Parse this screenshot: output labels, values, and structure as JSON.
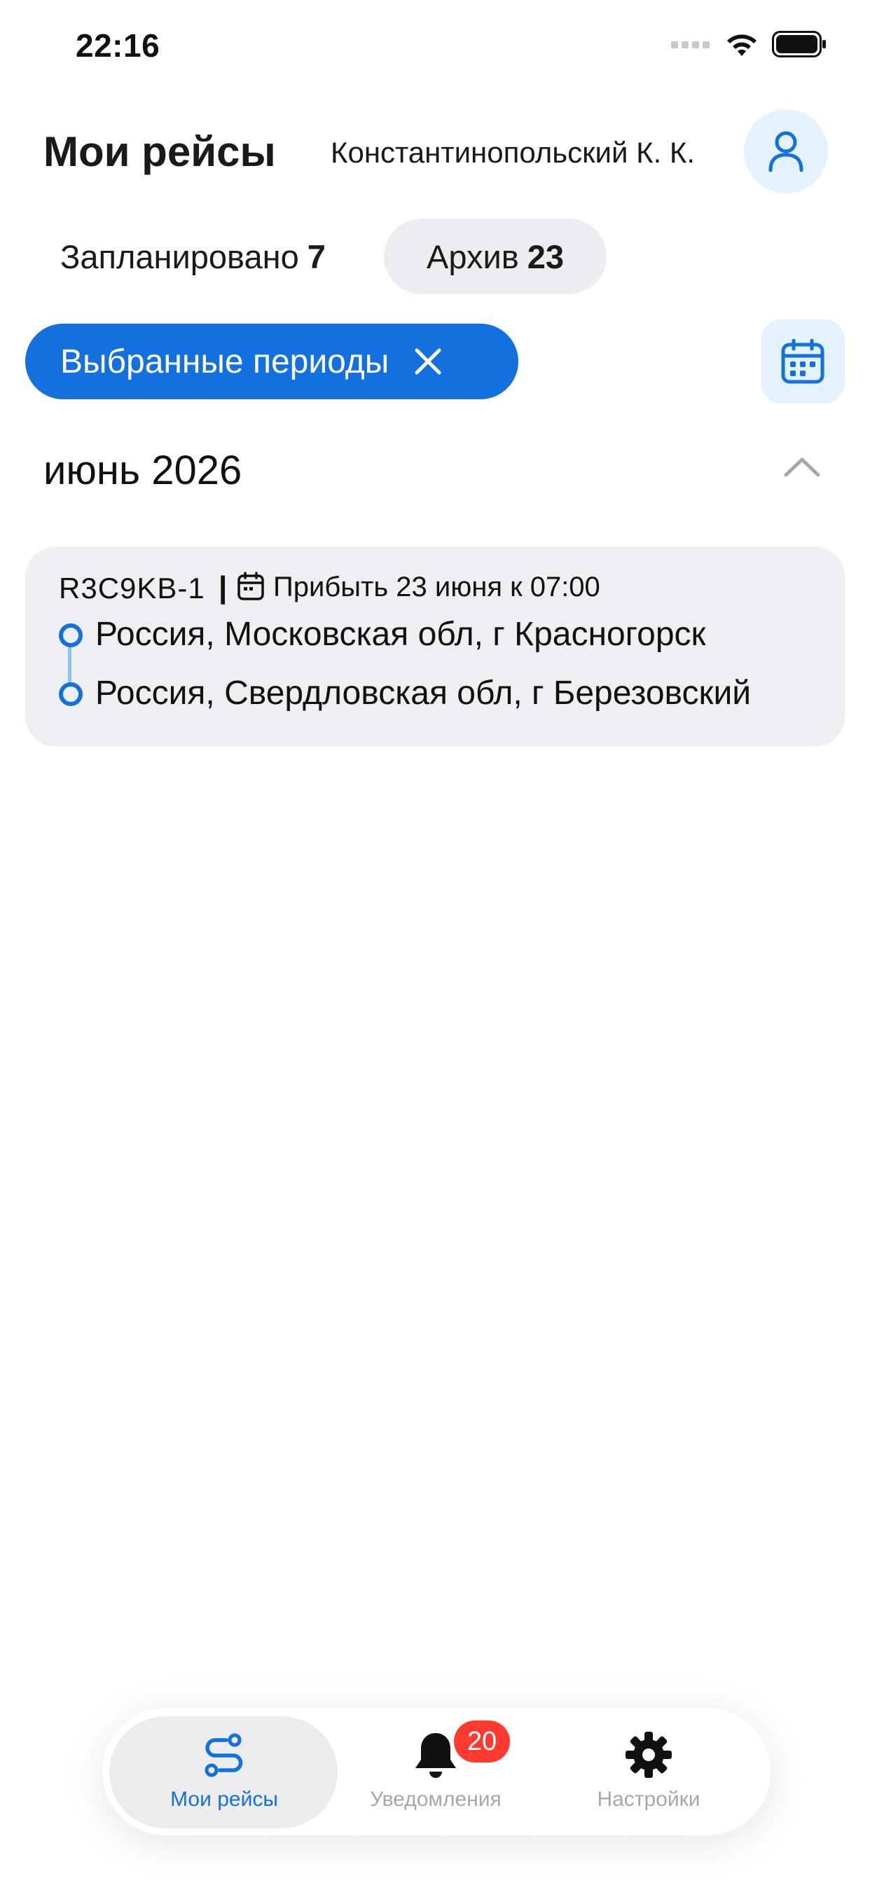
{
  "status_bar": {
    "time": "22:16",
    "icons": [
      "signal-icon",
      "wifi-icon",
      "battery-icon"
    ]
  },
  "header": {
    "title": "Мои рейсы",
    "user_name": "Константинопольский К. К.",
    "avatar_icon": "user-icon"
  },
  "tabs": [
    {
      "label": "Запланировано",
      "count": "7",
      "active": false
    },
    {
      "label": "Архив",
      "count": "23",
      "active": true
    }
  ],
  "filter": {
    "chip_label": "Выбранные периоды",
    "clear_icon": "close-icon",
    "calendar_icon": "calendar-icon"
  },
  "sections": [
    {
      "month": "июнь 2026",
      "collapse_icon": "chevron-up-icon",
      "trips": [
        {
          "id": "R3C9KB-1",
          "separator": "|",
          "arrival": "Прибыть 23 июня к 07:00",
          "from": "Россия, Московская обл, г Красногорск",
          "to": "Россия, Свердловская обл, г Березовский"
        }
      ]
    }
  ],
  "bottom_nav": {
    "items": [
      {
        "label": "Мои рейсы",
        "icon": "route-icon",
        "active": true
      },
      {
        "label": "Уведомления",
        "icon": "bell-icon",
        "badge": "20",
        "active": false
      },
      {
        "label": "Настройки",
        "icon": "gear-icon",
        "active": false
      }
    ]
  },
  "colors": {
    "accent": "#1271de",
    "accent_light": "#e3f2fc",
    "card_bg": "#edeff3",
    "badge": "#ff3b30",
    "inactive": "#a7a7ab"
  }
}
